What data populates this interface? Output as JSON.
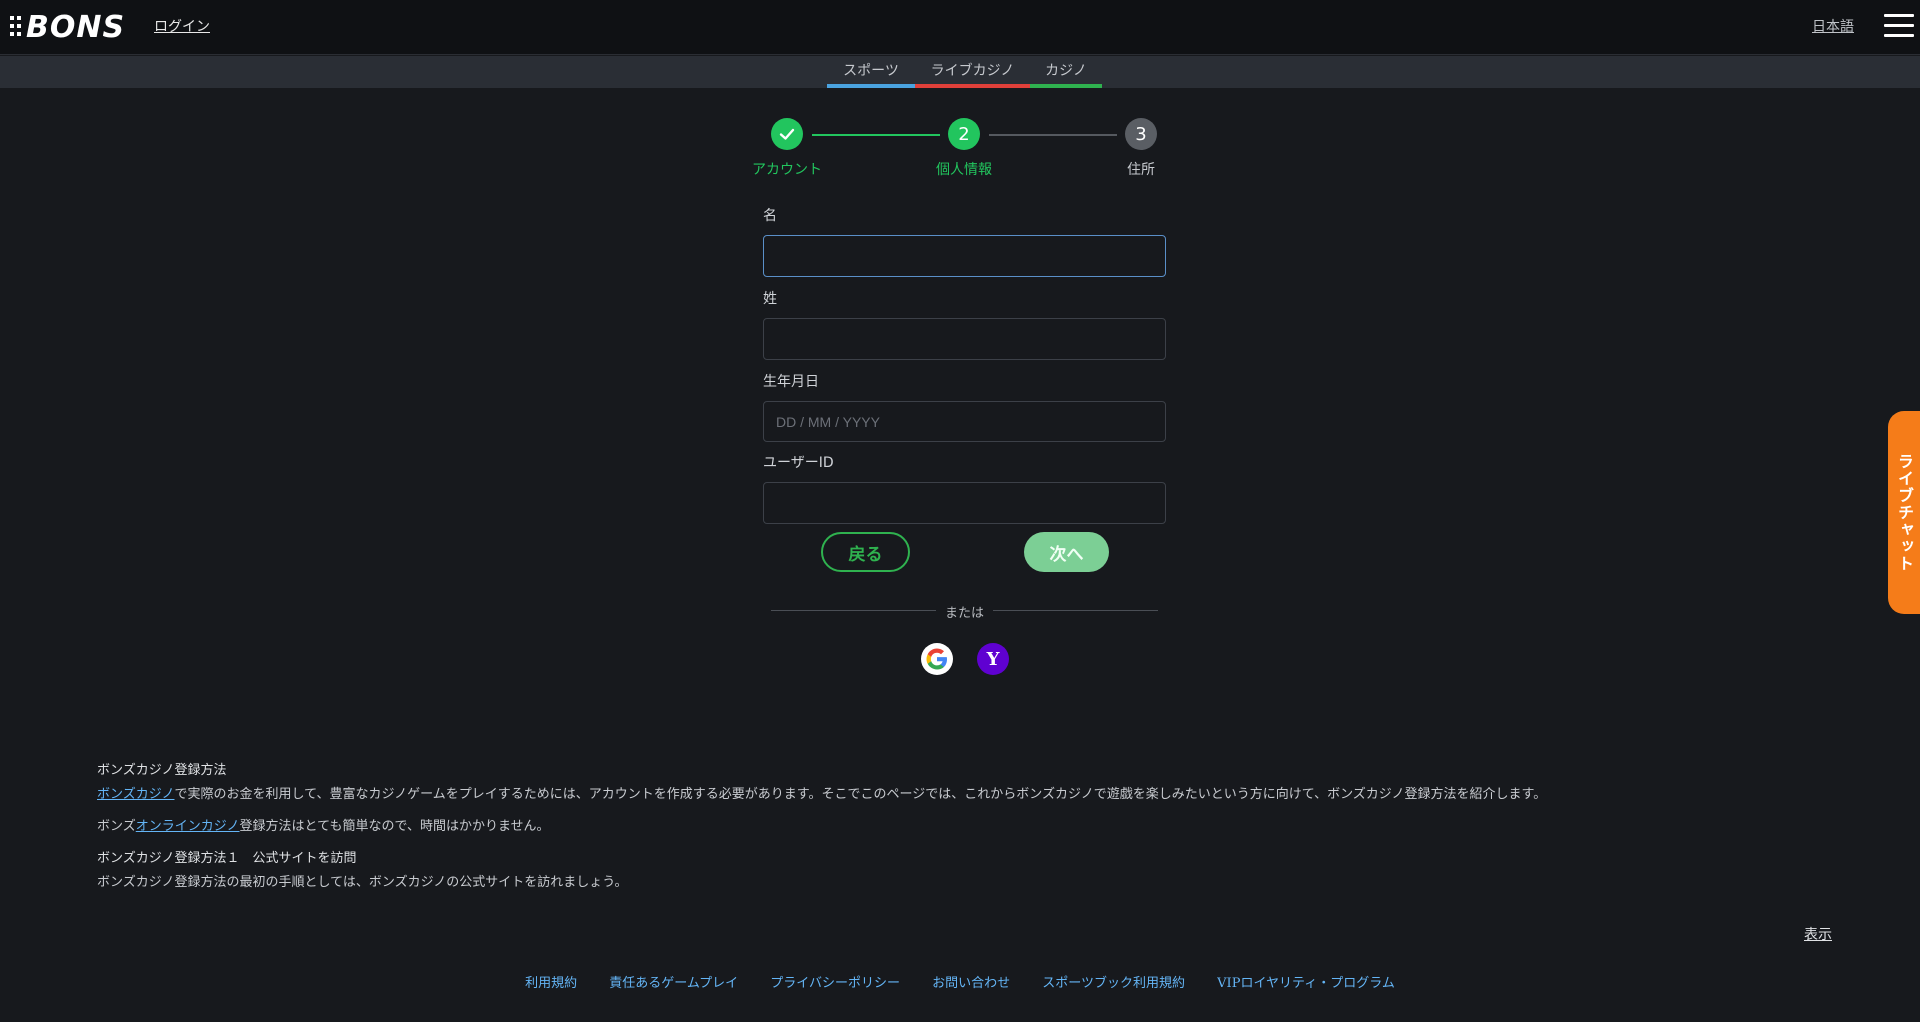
{
  "header": {
    "logo_text": "BONS",
    "login_label": "ログイン",
    "language_label": "日本語"
  },
  "subnav": {
    "tabs": [
      {
        "label": "スポーツ",
        "color": "#4aa3e0"
      },
      {
        "label": "ライブカジノ",
        "color": "#e0403a"
      },
      {
        "label": "カジノ",
        "color": "#2fb24f"
      }
    ]
  },
  "stepper": {
    "steps": [
      {
        "number": "✓",
        "label": "アカウント",
        "state": "done"
      },
      {
        "number": "2",
        "label": "個人情報",
        "state": "active"
      },
      {
        "number": "3",
        "label": "住所",
        "state": "pending"
      }
    ]
  },
  "form": {
    "first_name_label": "名",
    "first_name_value": "",
    "last_name_label": "姓",
    "last_name_value": "",
    "dob_label": "生年月日",
    "dob_placeholder": "DD / MM / YYYY",
    "userid_label": "ユーザーID",
    "userid_value": "",
    "back_label": "戻る",
    "next_label": "次へ",
    "or_text": "または"
  },
  "info": {
    "title1": "ボンズカジノ登録方法",
    "p1_link": "ボンズカジノ",
    "p1_text": "で実際のお金を利用して、豊富なカジノゲームをプレイするためには、アカウントを作成する必要があります。そこでこのページでは、これからボンズカジノで遊戯を楽しみたいという方に向けて、ボンズカジノ登録方法を紹介します。",
    "p2_prefix": "ボンズ",
    "p2_link": "オンラインカジノ",
    "p2_text": "登録方法はとても簡単なので、時間はかかりません。",
    "title2": "ボンズカジノ登録方法１　公式サイトを訪問",
    "p3_text": "ボンズカジノ登録方法の最初の手順としては、ボンズカジノの公式サイトを訪れましょう。",
    "show_label": "表示"
  },
  "footer": {
    "links": [
      "利用規約",
      "責任あるゲームプレイ",
      "プライバシーポリシー",
      "お問い合わせ",
      "スポーツブック利用規約",
      "VIPロイヤリティ・プログラム"
    ]
  },
  "livechat_label": "ライブチャット"
}
